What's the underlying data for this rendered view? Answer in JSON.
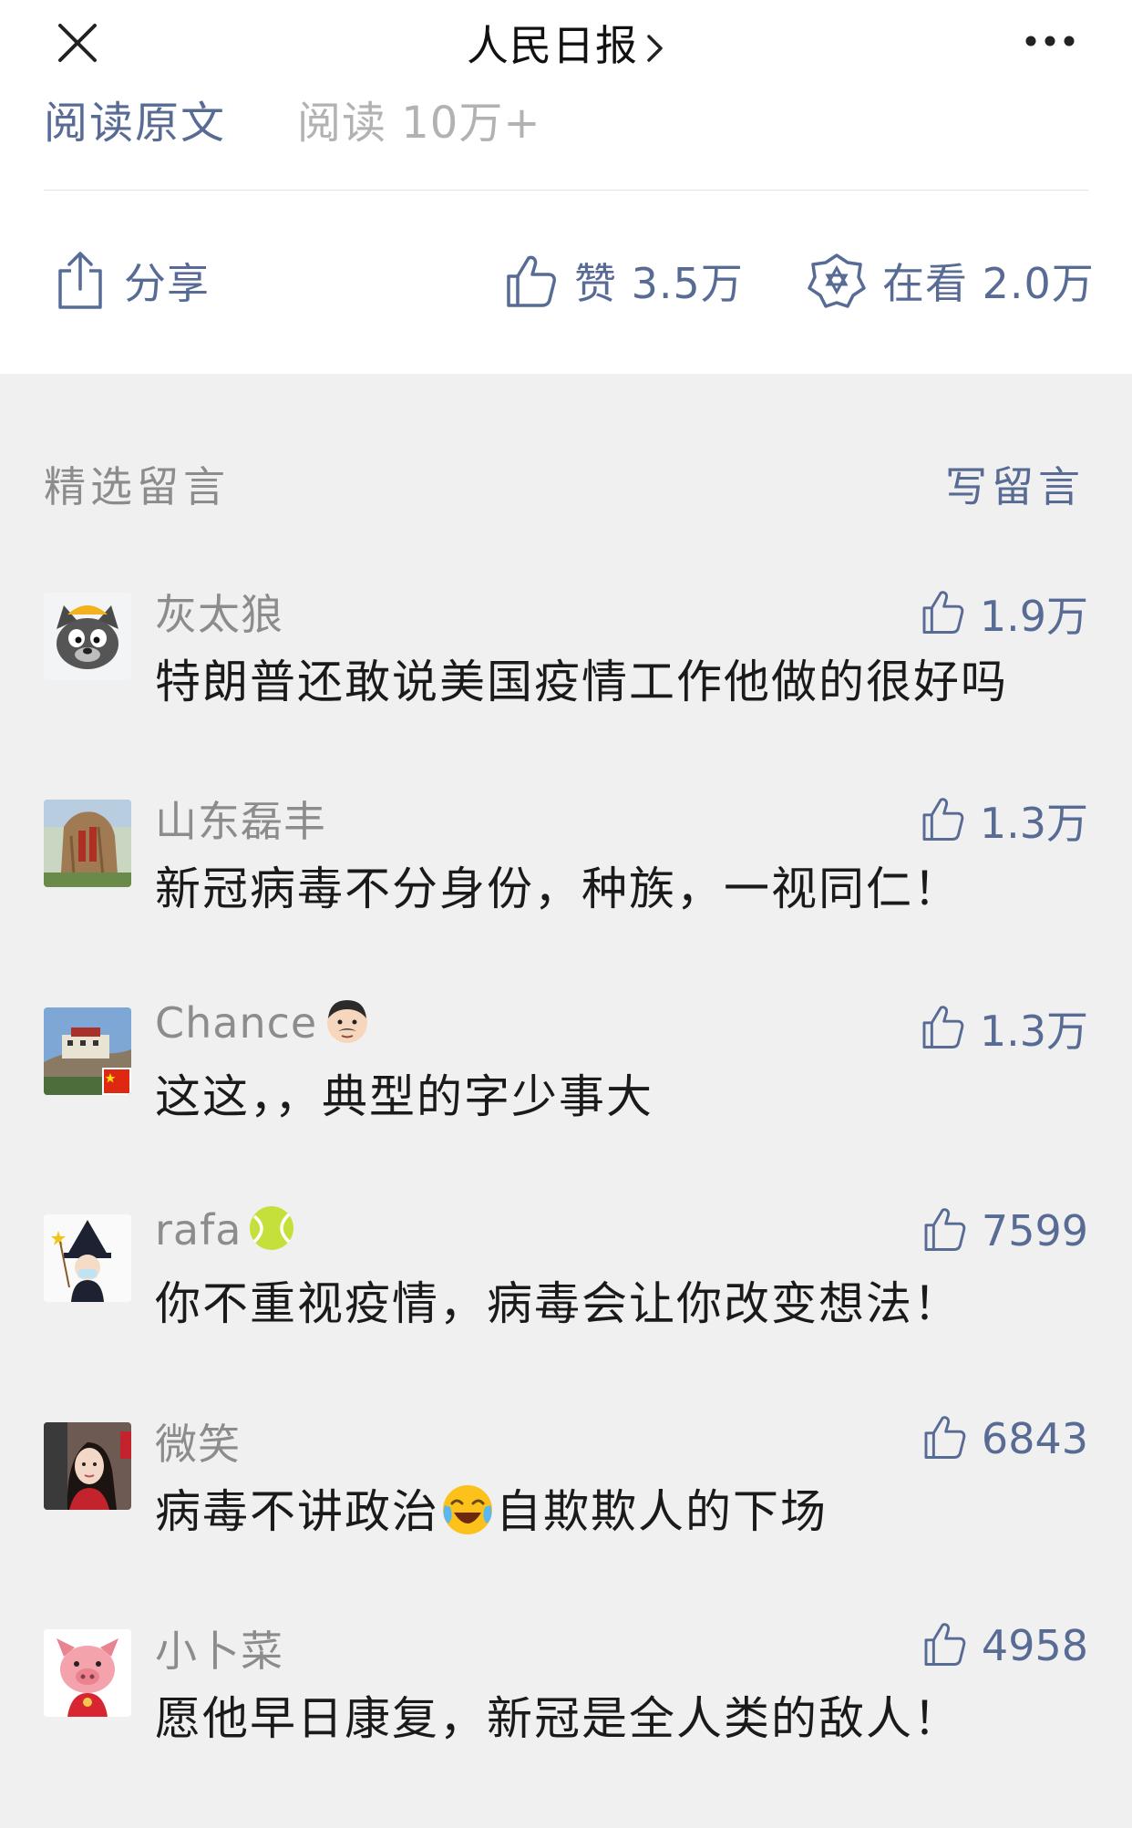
{
  "nav": {
    "title": "人民日报",
    "close_icon": "close-icon",
    "more_icon": "more-icon"
  },
  "article": {
    "read_original": "阅读原文",
    "read_count": "阅读 10万+",
    "share_label": "分享",
    "like_label": "赞 3.5万",
    "watch_label": "在看 2.0万"
  },
  "comments_section": {
    "title": "精选留言",
    "write_label": "写留言",
    "items": [
      {
        "name": "灰太狼",
        "likes": "1.9万",
        "text": "特朗普还敢说美国疫情工作他做的很好吗",
        "avatar": "grey-wolf-avatar"
      },
      {
        "name": "山东磊丰",
        "likes": "1.3万",
        "text": "新冠病毒不分身份，种族，一视同仁！",
        "avatar": "rock-avatar"
      },
      {
        "name": "Chance",
        "likes": "1.3万",
        "text": "这这，，典型的字少事大",
        "avatar": "palace-avatar",
        "name_emoji": "man-face-emoji"
      },
      {
        "name": "rafa",
        "likes": "7599",
        "text": "你不重视疫情，病毒会让你改变想法！",
        "avatar": "wizard-avatar",
        "name_emoji": "tennis-ball-emoji"
      },
      {
        "name": "微笑",
        "likes": "6843",
        "text_before": "病毒不讲政治",
        "text_after": "自欺欺人的下场",
        "avatar": "woman-avatar",
        "text_emoji": "crying-laughing-emoji"
      },
      {
        "name": "小卜菜",
        "likes": "4958",
        "text": "愿他早日康复，新冠是全人类的敌人！",
        "avatar": "pig-avatar"
      }
    ]
  },
  "colors": {
    "link": "#576b95",
    "muted": "#8c8c8c",
    "text": "#1a1a1a",
    "background": "#f0f0f0"
  }
}
